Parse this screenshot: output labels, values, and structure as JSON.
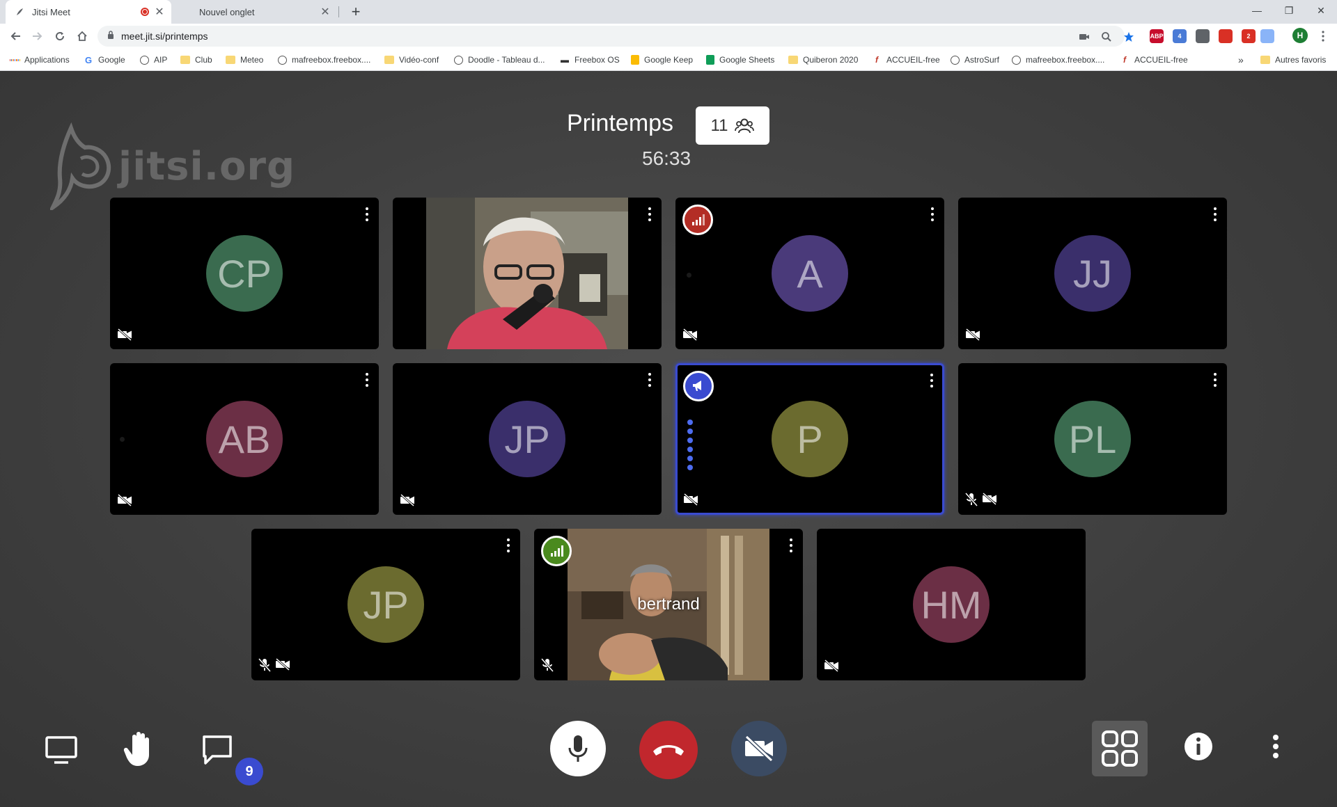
{
  "browser": {
    "tabs": [
      {
        "title": "Jitsi Meet",
        "active": true,
        "recording": true
      },
      {
        "title": "Nouvel onglet",
        "active": false,
        "recording": false
      }
    ],
    "url": "meet.jit.si/printemps",
    "bookmarks": [
      {
        "label": "Applications",
        "icon": "apps-icon"
      },
      {
        "label": "Google",
        "icon": "google-icon"
      },
      {
        "label": "AIP",
        "icon": "globe-icon"
      },
      {
        "label": "Club",
        "icon": "folder-icon"
      },
      {
        "label": "Meteo",
        "icon": "folder-icon"
      },
      {
        "label": "mafreebox.freebox....",
        "icon": "globe-icon"
      },
      {
        "label": "Vidéo-conf",
        "icon": "folder-icon"
      },
      {
        "label": "Doodle - Tableau d...",
        "icon": "globe-icon"
      },
      {
        "label": "Freebox OS",
        "icon": "freebox-icon"
      },
      {
        "label": "Google Keep",
        "icon": "keep-icon"
      },
      {
        "label": "Google Sheets",
        "icon": "sheets-icon"
      },
      {
        "label": "Quiberon 2020",
        "icon": "folder-icon"
      },
      {
        "label": "ACCUEIL-free",
        "icon": "free-icon"
      },
      {
        "label": "AstroSurf",
        "icon": "globe-icon"
      },
      {
        "label": "mafreebox.freebox....",
        "icon": "globe-icon"
      },
      {
        "label": "ACCUEIL-free",
        "icon": "free-icon"
      }
    ],
    "bookmarks_overflow": "»",
    "other_bookmarks": "Autres favoris",
    "extensions": [
      {
        "label": "ABP",
        "color": "#c70d2c"
      },
      {
        "label": "4",
        "color": "#4a7bd6"
      },
      {
        "label": "",
        "color": "#5f6368"
      },
      {
        "label": "",
        "color": "#d93025"
      },
      {
        "label": "2",
        "color": "#d93025"
      },
      {
        "label": "",
        "color": "#8ab4f8"
      }
    ],
    "profile_initial": "H",
    "colors": {
      "profile": "#1e7e34"
    }
  },
  "meeting": {
    "watermark": "jitsi.org",
    "room_name": "Printemps",
    "participant_count": "11",
    "duration": "56:33",
    "tiles": [
      {
        "initials": "CP",
        "color": "#3a6b4f",
        "video": false,
        "mic_muted": false,
        "cam_muted": true,
        "badge": null
      },
      {
        "initials": "",
        "color": "",
        "video": true,
        "video_style": "man-red-sweater",
        "mic_muted": false,
        "cam_muted": false,
        "badge": null
      },
      {
        "initials": "A",
        "color": "#4a3a7a",
        "video": false,
        "mic_muted": false,
        "cam_muted": true,
        "badge": "connection-poor"
      },
      {
        "initials": "JJ",
        "color": "#3a2f6b",
        "video": false,
        "mic_muted": false,
        "cam_muted": true,
        "badge": null
      },
      {
        "initials": "AB",
        "color": "#6b2f45",
        "video": false,
        "mic_muted": false,
        "cam_muted": true,
        "badge": null
      },
      {
        "initials": "JP",
        "color": "#3a2f6b",
        "video": false,
        "mic_muted": false,
        "cam_muted": true,
        "badge": null
      },
      {
        "initials": "P",
        "color": "#6b6b2f",
        "video": false,
        "mic_muted": false,
        "cam_muted": true,
        "badge": "dominant-speaker",
        "dominant": true
      },
      {
        "initials": "PL",
        "color": "#3a6b4f",
        "video": false,
        "mic_muted": true,
        "cam_muted": true,
        "badge": null
      },
      {
        "initials": "JP",
        "color": "#6b6b2f",
        "video": false,
        "mic_muted": true,
        "cam_muted": true,
        "badge": null
      },
      {
        "initials": "",
        "color": "",
        "video": true,
        "video_style": "room-person",
        "name": "bertrand",
        "mic_muted": true,
        "cam_muted": false,
        "badge": "connection-good"
      },
      {
        "initials": "HM",
        "color": "#6b2f45",
        "video": false,
        "mic_muted": false,
        "cam_muted": true,
        "badge": null
      }
    ]
  },
  "toolbar": {
    "left": [
      "screenshare-icon",
      "raise-hand-icon",
      "chat-icon"
    ],
    "chat_unread": "9",
    "center": [
      "microphone-icon",
      "hangup-icon",
      "camera-off-icon"
    ],
    "right": [
      "tile-view-icon",
      "info-icon",
      "more-icon"
    ],
    "colors": {
      "hangup": "#c1272d",
      "camera": "#3b4b63",
      "mic": "#ffffff",
      "tile_active": "#5a5a5a"
    }
  }
}
